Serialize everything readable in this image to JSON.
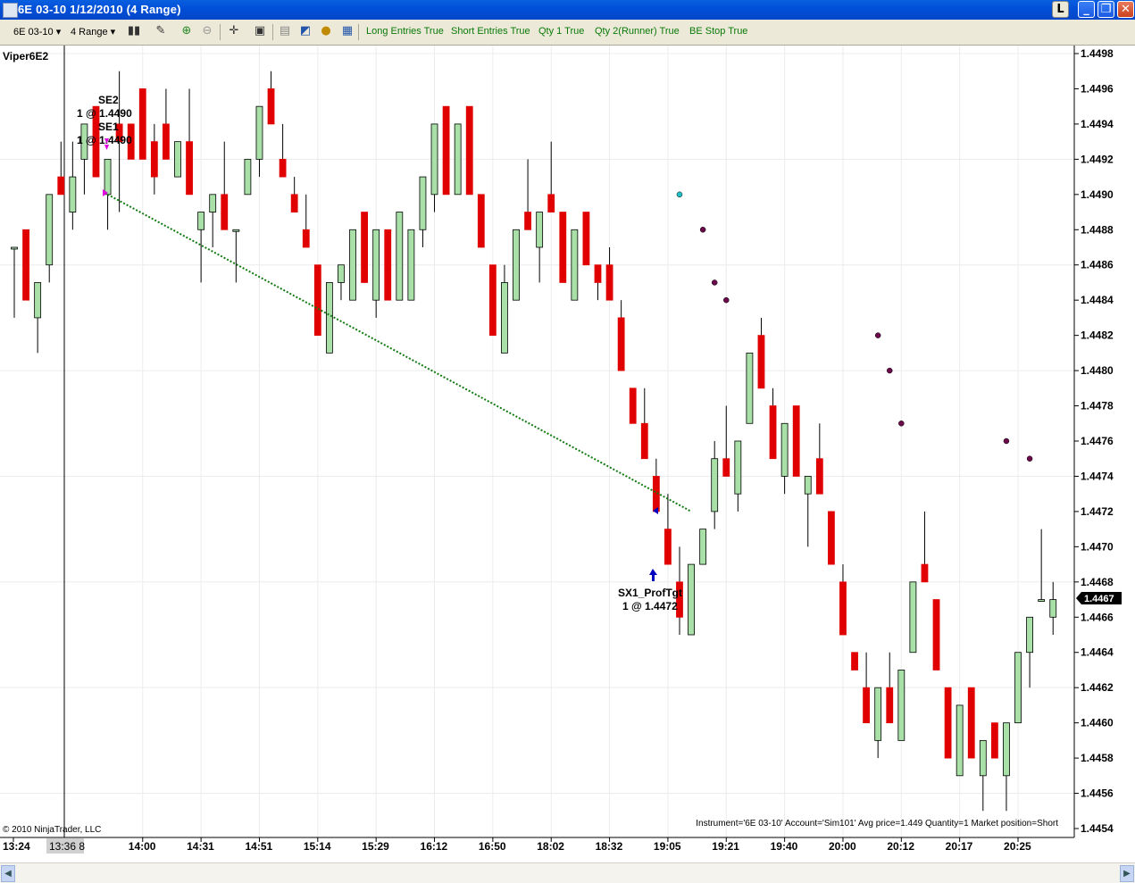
{
  "window": {
    "title": "6E 03-10  1/12/2010 (4 Range)",
    "buttons": [
      "L",
      "_",
      "❐",
      "✕"
    ]
  },
  "toolbar": {
    "instrument": "6E 03-10",
    "period": "4 Range",
    "strategy_params": [
      "Long Entries True",
      "Short Entries True",
      "Qty 1 True",
      "Qty 2(Runner) True",
      "BE Stop True"
    ]
  },
  "chart": {
    "strategy_label": "Viper6E2",
    "copyright": "© 2010 NinjaTrader, LLC",
    "status_text": "Instrument='6E 03-10' Account='Sim101' Avg price=1.449 Quantity=1 Market position=Short",
    "last_price": "1.4467",
    "crosshair_time": "13:36 8",
    "price_axis": [
      "1.4498",
      "1.4496",
      "1.4494",
      "1.4492",
      "1.4490",
      "1.4488",
      "1.4486",
      "1.4484",
      "1.4482",
      "1.4480",
      "1.4478",
      "1.4476",
      "1.4474",
      "1.4472",
      "1.4470",
      "1.4468",
      "1.4466",
      "1.4464",
      "1.4462",
      "1.4460",
      "1.4458",
      "1.4456",
      "1.4454"
    ],
    "time_axis": [
      "13:24",
      "14:00",
      "14:31",
      "14:51",
      "15:14",
      "15:29",
      "16:12",
      "16:50",
      "18:02",
      "18:32",
      "19:05",
      "19:21",
      "19:40",
      "20:00",
      "20:12",
      "20:17",
      "20:25"
    ],
    "markers": {
      "se2": {
        "name": "SE2",
        "fill": "1 @ 1.4490"
      },
      "se1": {
        "name": "SE1",
        "fill": "1 @ 1.4490"
      },
      "sx1": {
        "name": "SX1_ProfTgt",
        "fill": "1 @ 1.4472"
      }
    },
    "colors": {
      "up": "#a8e0a8",
      "down": "#e00000",
      "trade_line": "#137a13",
      "stop_dots": "#6a0a4a"
    }
  },
  "chart_data": {
    "type": "candlestick",
    "y_range": [
      1.4453,
      1.4499
    ],
    "candles": [
      {
        "o": 1.4487,
        "h": 1.4487,
        "l": 1.4483,
        "c": 1.4487
      },
      {
        "o": 1.4488,
        "h": 1.4488,
        "l": 1.4484,
        "c": 1.4484
      },
      {
        "o": 1.4483,
        "h": 1.4485,
        "l": 1.4481,
        "c": 1.4485
      },
      {
        "o": 1.4486,
        "h": 1.449,
        "l": 1.4485,
        "c": 1.449
      },
      {
        "o": 1.4491,
        "h": 1.4493,
        "l": 1.449,
        "c": 1.449
      },
      {
        "o": 1.4489,
        "h": 1.4493,
        "l": 1.4488,
        "c": 1.4491
      },
      {
        "o": 1.4492,
        "h": 1.4494,
        "l": 1.449,
        "c": 1.4494
      },
      {
        "o": 1.4495,
        "h": 1.4495,
        "l": 1.4491,
        "c": 1.4491
      },
      {
        "o": 1.449,
        "h": 1.4492,
        "l": 1.4488,
        "c": 1.4492
      },
      {
        "o": 1.4494,
        "h": 1.4497,
        "l": 1.4489,
        "c": 1.4493
      },
      {
        "o": 1.4494,
        "h": 1.4494,
        "l": 1.4492,
        "c": 1.4492
      },
      {
        "o": 1.4496,
        "h": 1.4496,
        "l": 1.4492,
        "c": 1.4492
      },
      {
        "o": 1.4493,
        "h": 1.4494,
        "l": 1.449,
        "c": 1.4491
      },
      {
        "o": 1.4494,
        "h": 1.4496,
        "l": 1.4492,
        "c": 1.4492
      },
      {
        "o": 1.4491,
        "h": 1.4493,
        "l": 1.4491,
        "c": 1.4493
      },
      {
        "o": 1.4493,
        "h": 1.4496,
        "l": 1.449,
        "c": 1.449
      },
      {
        "o": 1.4488,
        "h": 1.4489,
        "l": 1.4485,
        "c": 1.4489
      },
      {
        "o": 1.4489,
        "h": 1.449,
        "l": 1.4487,
        "c": 1.449
      },
      {
        "o": 1.449,
        "h": 1.4493,
        "l": 1.4488,
        "c": 1.4488
      },
      {
        "o": 1.4488,
        "h": 1.4488,
        "l": 1.4485,
        "c": 1.4488
      },
      {
        "o": 1.449,
        "h": 1.4492,
        "l": 1.449,
        "c": 1.4492
      },
      {
        "o": 1.4492,
        "h": 1.4495,
        "l": 1.4491,
        "c": 1.4495
      },
      {
        "o": 1.4496,
        "h": 1.4497,
        "l": 1.4494,
        "c": 1.4494
      },
      {
        "o": 1.4492,
        "h": 1.4494,
        "l": 1.4491,
        "c": 1.4491
      },
      {
        "o": 1.449,
        "h": 1.4491,
        "l": 1.4489,
        "c": 1.4489
      },
      {
        "o": 1.4488,
        "h": 1.449,
        "l": 1.4487,
        "c": 1.4487
      },
      {
        "o": 1.4486,
        "h": 1.4486,
        "l": 1.4482,
        "c": 1.4482
      },
      {
        "o": 1.4481,
        "h": 1.4485,
        "l": 1.4481,
        "c": 1.4485
      },
      {
        "o": 1.4485,
        "h": 1.4486,
        "l": 1.4484,
        "c": 1.4486
      },
      {
        "o": 1.4484,
        "h": 1.4488,
        "l": 1.4484,
        "c": 1.4488
      },
      {
        "o": 1.4489,
        "h": 1.4489,
        "l": 1.4485,
        "c": 1.4485
      },
      {
        "o": 1.4484,
        "h": 1.4488,
        "l": 1.4483,
        "c": 1.4488
      },
      {
        "o": 1.4488,
        "h": 1.4488,
        "l": 1.4484,
        "c": 1.4484
      },
      {
        "o": 1.4484,
        "h": 1.4489,
        "l": 1.4484,
        "c": 1.4489
      },
      {
        "o": 1.4484,
        "h": 1.4488,
        "l": 1.4484,
        "c": 1.4488
      },
      {
        "o": 1.4488,
        "h": 1.4491,
        "l": 1.4487,
        "c": 1.4491
      },
      {
        "o": 1.449,
        "h": 1.4494,
        "l": 1.4489,
        "c": 1.4494
      },
      {
        "o": 1.4495,
        "h": 1.4495,
        "l": 1.449,
        "c": 1.449
      },
      {
        "o": 1.449,
        "h": 1.4494,
        "l": 1.449,
        "c": 1.4494
      },
      {
        "o": 1.4495,
        "h": 1.4495,
        "l": 1.449,
        "c": 1.449
      },
      {
        "o": 1.449,
        "h": 1.449,
        "l": 1.4487,
        "c": 1.4487
      },
      {
        "o": 1.4486,
        "h": 1.4486,
        "l": 1.4482,
        "c": 1.4482
      },
      {
        "o": 1.4481,
        "h": 1.4486,
        "l": 1.4481,
        "c": 1.4485
      },
      {
        "o": 1.4484,
        "h": 1.4488,
        "l": 1.4484,
        "c": 1.4488
      },
      {
        "o": 1.4489,
        "h": 1.4492,
        "l": 1.4488,
        "c": 1.4488
      },
      {
        "o": 1.4487,
        "h": 1.4489,
        "l": 1.4485,
        "c": 1.4489
      },
      {
        "o": 1.449,
        "h": 1.4493,
        "l": 1.4489,
        "c": 1.4489
      },
      {
        "o": 1.4489,
        "h": 1.4489,
        "l": 1.4485,
        "c": 1.4485
      },
      {
        "o": 1.4484,
        "h": 1.4488,
        "l": 1.4484,
        "c": 1.4488
      },
      {
        "o": 1.4489,
        "h": 1.4489,
        "l": 1.4486,
        "c": 1.4486
      },
      {
        "o": 1.4486,
        "h": 1.4486,
        "l": 1.4484,
        "c": 1.4485
      },
      {
        "o": 1.4486,
        "h": 1.4487,
        "l": 1.4484,
        "c": 1.4484
      },
      {
        "o": 1.4483,
        "h": 1.4484,
        "l": 1.448,
        "c": 1.448
      },
      {
        "o": 1.4479,
        "h": 1.4479,
        "l": 1.4477,
        "c": 1.4477
      },
      {
        "o": 1.4477,
        "h": 1.4479,
        "l": 1.4475,
        "c": 1.4475
      },
      {
        "o": 1.4474,
        "h": 1.4475,
        "l": 1.4472,
        "c": 1.4472
      },
      {
        "o": 1.4471,
        "h": 1.4473,
        "l": 1.4469,
        "c": 1.4469
      },
      {
        "o": 1.4468,
        "h": 1.447,
        "l": 1.4465,
        "c": 1.4466
      },
      {
        "o": 1.4465,
        "h": 1.4469,
        "l": 1.4465,
        "c": 1.4469
      },
      {
        "o": 1.4469,
        "h": 1.4471,
        "l": 1.4469,
        "c": 1.4471
      },
      {
        "o": 1.4472,
        "h": 1.4476,
        "l": 1.4471,
        "c": 1.4475
      },
      {
        "o": 1.4475,
        "h": 1.4478,
        "l": 1.4474,
        "c": 1.4474
      },
      {
        "o": 1.4473,
        "h": 1.4476,
        "l": 1.4472,
        "c": 1.4476
      },
      {
        "o": 1.4477,
        "h": 1.4481,
        "l": 1.4477,
        "c": 1.4481
      },
      {
        "o": 1.4482,
        "h": 1.4483,
        "l": 1.4479,
        "c": 1.4479
      },
      {
        "o": 1.4478,
        "h": 1.4479,
        "l": 1.4475,
        "c": 1.4475
      },
      {
        "o": 1.4474,
        "h": 1.4477,
        "l": 1.4473,
        "c": 1.4477
      },
      {
        "o": 1.4478,
        "h": 1.4478,
        "l": 1.4474,
        "c": 1.4474
      },
      {
        "o": 1.4473,
        "h": 1.4474,
        "l": 1.447,
        "c": 1.4474
      },
      {
        "o": 1.4475,
        "h": 1.4477,
        "l": 1.4473,
        "c": 1.4473
      },
      {
        "o": 1.4472,
        "h": 1.4472,
        "l": 1.4469,
        "c": 1.4469
      },
      {
        "o": 1.4468,
        "h": 1.4469,
        "l": 1.4465,
        "c": 1.4465
      },
      {
        "o": 1.4464,
        "h": 1.4464,
        "l": 1.4463,
        "c": 1.4463
      },
      {
        "o": 1.4462,
        "h": 1.4464,
        "l": 1.446,
        "c": 1.446
      },
      {
        "o": 1.4459,
        "h": 1.4462,
        "l": 1.4458,
        "c": 1.4462
      },
      {
        "o": 1.4462,
        "h": 1.4464,
        "l": 1.446,
        "c": 1.446
      },
      {
        "o": 1.4459,
        "h": 1.4463,
        "l": 1.4459,
        "c": 1.4463
      },
      {
        "o": 1.4464,
        "h": 1.4468,
        "l": 1.4464,
        "c": 1.4468
      },
      {
        "o": 1.4469,
        "h": 1.4472,
        "l": 1.4468,
        "c": 1.4468
      },
      {
        "o": 1.4467,
        "h": 1.4467,
        "l": 1.4463,
        "c": 1.4463
      },
      {
        "o": 1.4462,
        "h": 1.4462,
        "l": 1.4458,
        "c": 1.4458
      },
      {
        "o": 1.4457,
        "h": 1.4461,
        "l": 1.4457,
        "c": 1.4461
      },
      {
        "o": 1.4462,
        "h": 1.4462,
        "l": 1.4458,
        "c": 1.4458
      },
      {
        "o": 1.4457,
        "h": 1.4459,
        "l": 1.4455,
        "c": 1.4459
      },
      {
        "o": 1.446,
        "h": 1.446,
        "l": 1.4458,
        "c": 1.4458
      },
      {
        "o": 1.4457,
        "h": 1.446,
        "l": 1.4455,
        "c": 1.446
      },
      {
        "o": 1.446,
        "h": 1.4464,
        "l": 1.446,
        "c": 1.4464
      },
      {
        "o": 1.4464,
        "h": 1.4466,
        "l": 1.4462,
        "c": 1.4466
      },
      {
        "o": 1.4467,
        "h": 1.4471,
        "l": 1.4467,
        "c": 1.4467
      },
      {
        "o": 1.4466,
        "h": 1.4468,
        "l": 1.4465,
        "c": 1.4467
      }
    ],
    "stop_dots": [
      {
        "bar": 57,
        "y": 1.449,
        "color": "#20c0c8"
      },
      {
        "bar": 59,
        "y": 1.4488,
        "color": "#6a0a4a"
      },
      {
        "bar": 60,
        "y": 1.4485,
        "color": "#6a0a4a"
      },
      {
        "bar": 61,
        "y": 1.4484,
        "color": "#6a0a4a"
      },
      {
        "bar": 74,
        "y": 1.4482,
        "color": "#6a0a4a"
      },
      {
        "bar": 75,
        "y": 1.448,
        "color": "#6a0a4a"
      },
      {
        "bar": 76,
        "y": 1.4477,
        "color": "#6a0a4a"
      },
      {
        "bar": 85,
        "y": 1.4476,
        "color": "#6a0a4a"
      },
      {
        "bar": 87,
        "y": 1.4475,
        "color": "#6a0a4a"
      }
    ],
    "trade": {
      "entry_bar": 8,
      "entry_price": 1.449,
      "exit_bar": 58,
      "exit_price": 1.4472
    },
    "time_tick_bars": [
      0,
      11,
      16,
      21,
      26,
      31,
      36,
      41,
      46,
      51,
      56,
      61,
      66,
      71,
      76,
      81,
      86
    ]
  }
}
